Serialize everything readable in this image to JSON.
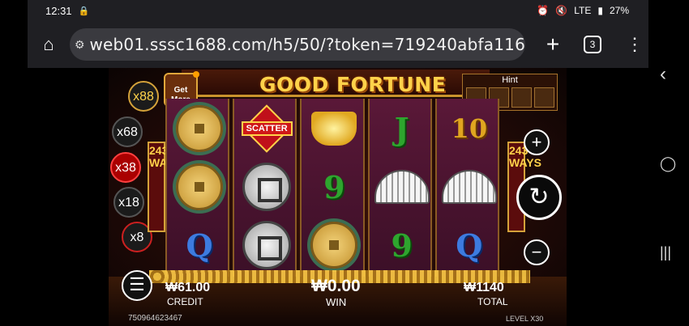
{
  "status": {
    "time": "12:31",
    "battery": "27%",
    "network": "LTE"
  },
  "browser": {
    "url": "web01.sssc1688.com/h5/50/?token=719240abfa116",
    "tab_count": "3"
  },
  "game": {
    "title": "GOOD FORTUNE",
    "get_more": "Get More",
    "hint_label": "Hint",
    "multipliers": [
      "x88",
      "x68",
      "x38",
      "x18",
      "x8"
    ],
    "ways": "243 WAYS",
    "scatter_label": "SCATTER",
    "credit_value": "₩61.00",
    "credit_label": "CREDIT",
    "win_value": "₩0.00",
    "win_label": "WIN",
    "total_value": "₩1140",
    "total_label": "TOTAL",
    "footer_id": "750964623467",
    "level_label": "LEVEL",
    "level_value": "X30"
  }
}
